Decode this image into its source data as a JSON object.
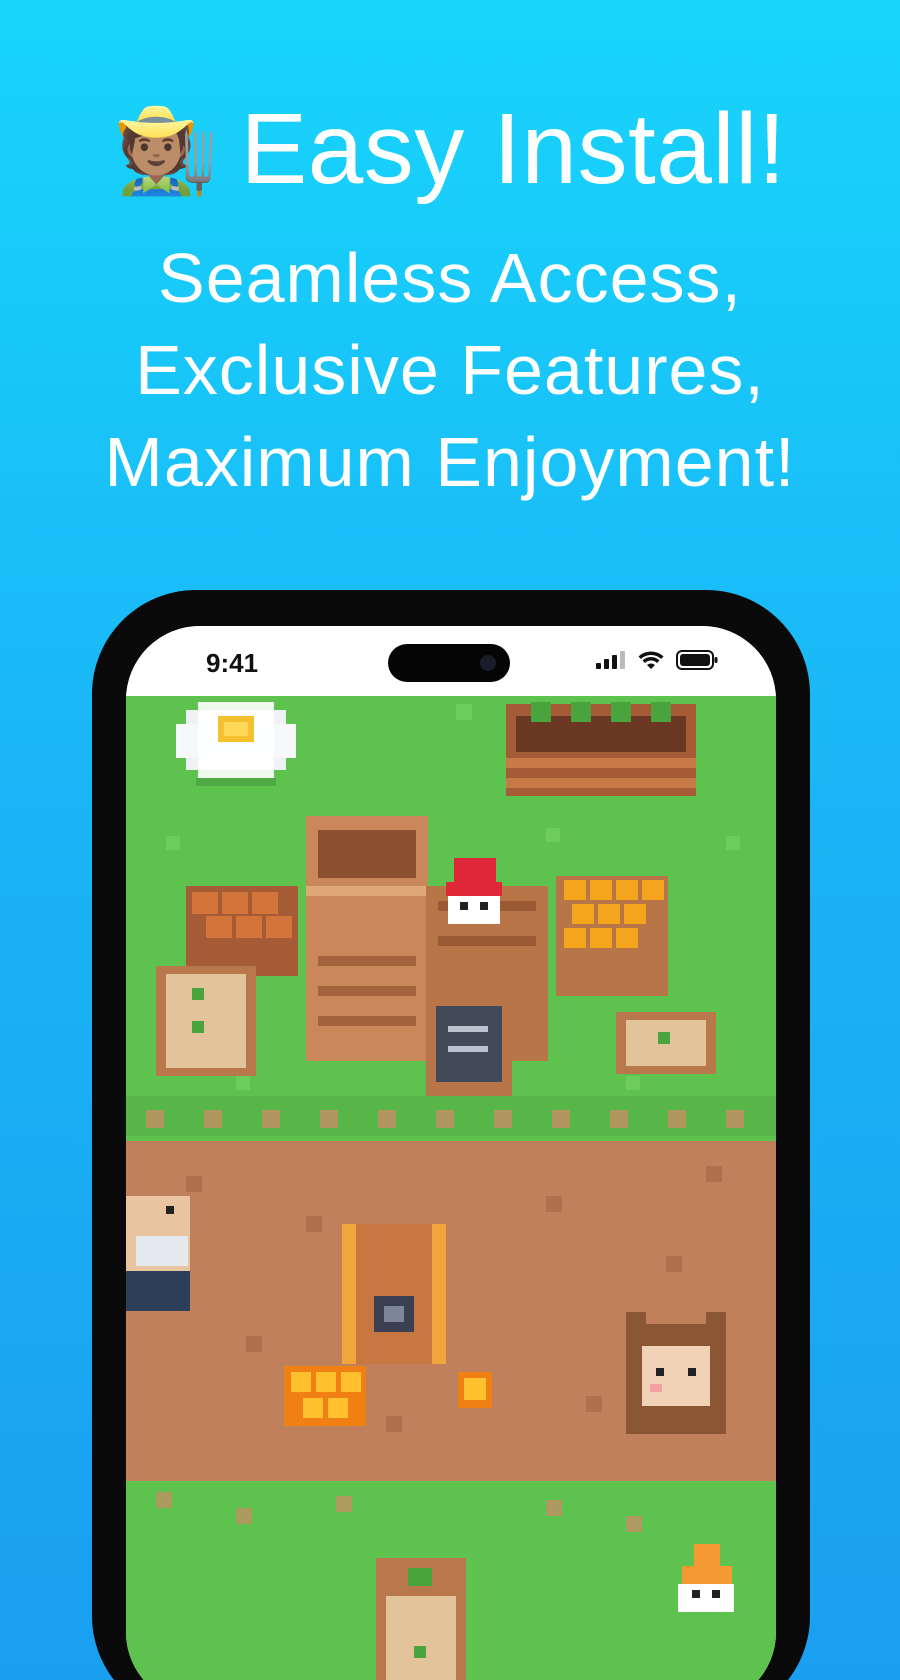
{
  "header": {
    "emoji": "🧑🏽‍🌾",
    "title": "Easy Install!",
    "subtitle_lines": [
      "Seamless Access,",
      "Exclusive Features,",
      "Maximum Enjoyment!"
    ]
  },
  "phone": {
    "status_bar": {
      "time": "9:41",
      "icons": [
        "cellular-signal-icon",
        "wifi-icon",
        "battery-icon"
      ]
    },
    "game_scene": {
      "description_icons": [
        "daisy-flower",
        "planter-box",
        "wooden-crates",
        "gnome-red-hat",
        "chalkboard-sign",
        "old-farmer",
        "wooden-chest",
        "bear-hood-kid",
        "gnome-orange-hat",
        "seed-sack"
      ]
    }
  },
  "colors": {
    "background_top": "#17d5fb",
    "background_bottom": "#1a9ff0",
    "grass": "#5ec24f",
    "dirt_path": "#c0805c",
    "phone_frame": "#0a0a0a"
  }
}
